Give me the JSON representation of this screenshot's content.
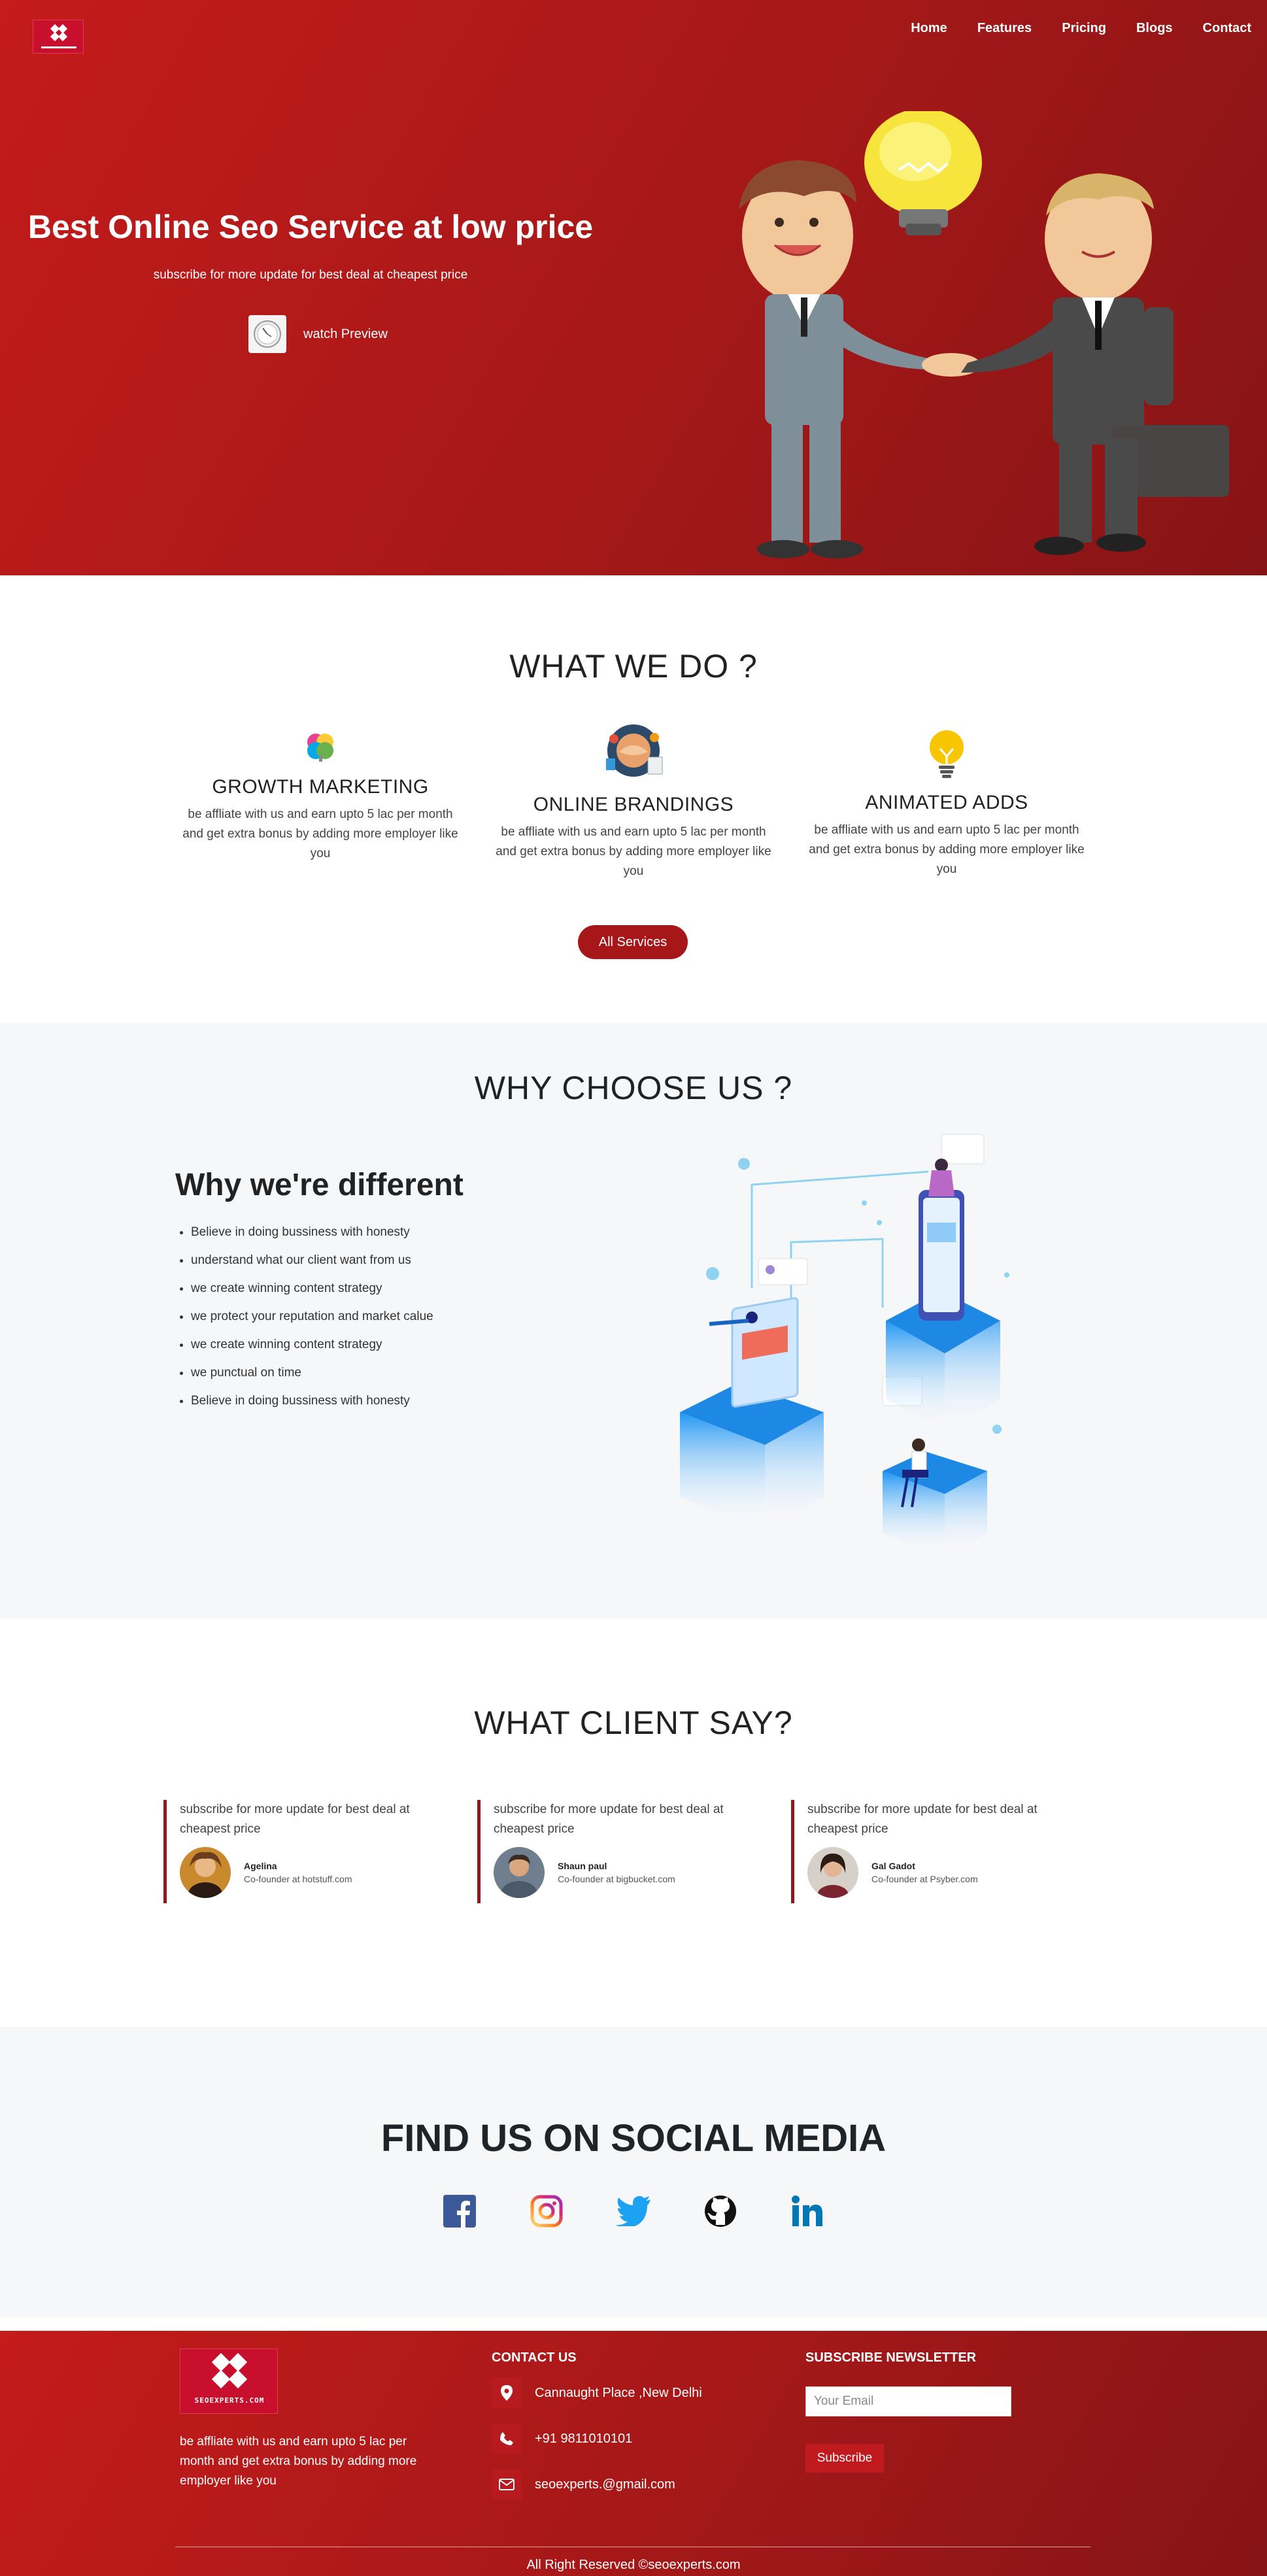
{
  "nav": {
    "items": [
      "Home",
      "Features",
      "Pricing",
      "Blogs",
      "Contact"
    ]
  },
  "hero": {
    "title": "Best Online Seo Service at low price",
    "subtitle": "subscribe for more update for best deal at cheapest price",
    "watch_label": "watch Preview"
  },
  "what_we_do": {
    "title": "WHAT WE DO ?",
    "services": [
      {
        "title": "GROWTH MARKETING",
        "desc": "be affliate with us and earn upto 5 lac per month and get extra bonus by adding more employer like you",
        "icon": "brain-icon"
      },
      {
        "title": "ONLINE BRANDINGS",
        "desc": "be affliate with us and earn upto 5 lac per month and get extra bonus by adding more employer like you",
        "icon": "handshake-globe-icon"
      },
      {
        "title": "ANIMATED ADDS",
        "desc": "be affliate with us and earn upto 5 lac per month and get extra bonus by adding more employer like you",
        "icon": "lightbulb-icon"
      }
    ],
    "button": "All Services"
  },
  "why": {
    "title": "WHY CHOOSE US ?",
    "heading": "Why we're different",
    "points": [
      "Believe in doing bussiness with honesty",
      "understand what our client want from us",
      "we create winning content strategy",
      "we protect your reputation and market calue",
      "we create winning content strategy",
      "we punctual on time",
      "Believe in doing bussiness with honesty"
    ]
  },
  "testimonials": {
    "title": "WHAT CLIENT SAY?",
    "items": [
      {
        "text": "subscribe for more update for best deal at cheapest price",
        "name": "Agelina",
        "role": "Co-founder at hotstuff.com"
      },
      {
        "text": "subscribe for more update for best deal at cheapest price",
        "name": "Shaun paul",
        "role": "Co-founder at bigbucket.com"
      },
      {
        "text": "subscribe for more update for best deal at cheapest price",
        "name": "Gal Gadot",
        "role": "Co-founder at Psyber.com"
      }
    ]
  },
  "social": {
    "title": "FIND US ON SOCIAL MEDIA",
    "icons": [
      "facebook-icon",
      "instagram-icon",
      "twitter-icon",
      "github-icon",
      "linkedin-icon"
    ]
  },
  "footer": {
    "logo_text": "SEOEXPERTS.COM",
    "about": "be affliate with us and earn upto 5 lac per month and get extra bonus by adding more employer like you",
    "contact_heading": "CONTACT US",
    "address": "Cannaught Place ,New Delhi",
    "phone": "+91 9811010101",
    "email": "seoexperts.@gmail.com",
    "newsletter_heading": "SUBSCRIBE NEWSLETTER",
    "email_placeholder": "Your Email",
    "subscribe_label": "Subscribe",
    "copyright": "All Right Reserved ©seoexperts.com"
  },
  "colors": {
    "brand_red": "#a51818",
    "heading_dark": "#222222",
    "section_gray": "#f6f7f9",
    "testimonial_border": "#8d1a1f"
  }
}
